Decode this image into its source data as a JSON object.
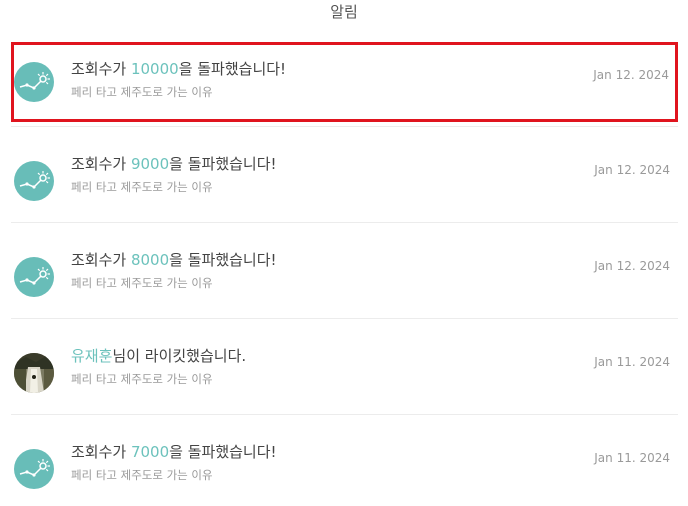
{
  "header": {
    "title": "알림"
  },
  "notifications": [
    {
      "prefix": "조회수가 ",
      "highlight": "10000",
      "suffix": "을 돌파했습니다!",
      "subtitle": "페리 타고 제주도로 가는 이유",
      "date": "Jan 12. 2024",
      "avatar": "chart-icon",
      "selected": true
    },
    {
      "prefix": "조회수가 ",
      "highlight": "9000",
      "suffix": "을 돌파했습니다!",
      "subtitle": "페리 타고 제주도로 가는 이유",
      "date": "Jan 12. 2024",
      "avatar": "chart-icon",
      "selected": false
    },
    {
      "prefix": "조회수가 ",
      "highlight": "8000",
      "suffix": "을 돌파했습니다!",
      "subtitle": "페리 타고 제주도로 가는 이유",
      "date": "Jan 12. 2024",
      "avatar": "chart-icon",
      "selected": false
    },
    {
      "prefix": "",
      "highlight": "유재훈",
      "suffix": "님이 라이킷했습니다.",
      "subtitle": "페리 타고 제주도로 가는 이유",
      "date": "Jan 11. 2024",
      "avatar": "user-photo",
      "selected": false
    },
    {
      "prefix": "조회수가 ",
      "highlight": "7000",
      "suffix": "을 돌파했습니다!",
      "subtitle": "페리 타고 제주도로 가는 이유",
      "date": "Jan 11. 2024",
      "avatar": "chart-icon",
      "selected": false
    }
  ],
  "colors": {
    "accent": "#6cc2bc",
    "avatar_bg": "#68bdb8",
    "highlight_border": "#e0141e"
  }
}
